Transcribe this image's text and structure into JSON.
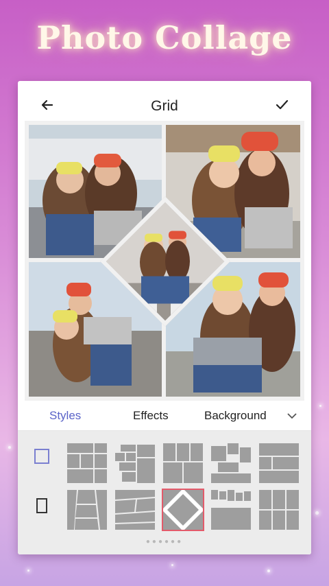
{
  "banner": {
    "title": "Photo Collage"
  },
  "appbar": {
    "title": "Grid",
    "back_icon": "back-arrow-icon",
    "done_icon": "checkmark-icon"
  },
  "tabs": [
    {
      "label": "Styles",
      "active": true
    },
    {
      "label": "Effects",
      "active": false
    },
    {
      "label": "Background",
      "active": false
    }
  ],
  "tabs_expand_icon": "chevron-down-icon",
  "panel": {
    "ratio_options": [
      {
        "name": "ratio-square",
        "active": true
      },
      {
        "name": "ratio-portrait",
        "active": false
      }
    ],
    "selected_layout": "diamond-center",
    "page_indicator": "●●●●●●"
  },
  "colors": {
    "accent": "#5a63c8",
    "selected_outline": "#e35a6a",
    "layout_block": "#9e9e9e"
  }
}
